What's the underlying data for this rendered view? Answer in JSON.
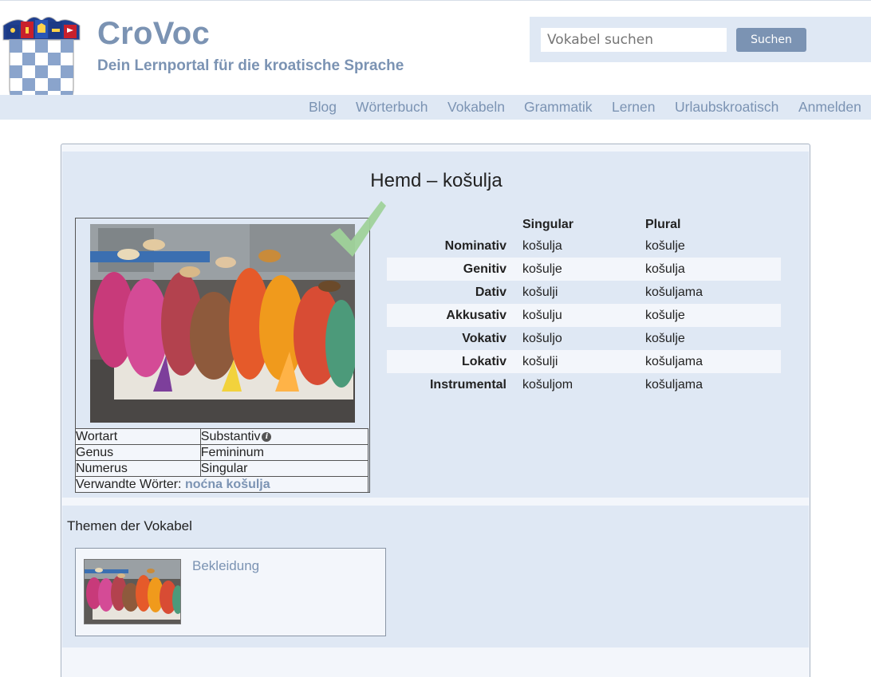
{
  "brand": {
    "title": "CroVoc",
    "subtitle": "Dein Lernportal für die kroatische Sprache"
  },
  "search": {
    "placeholder": "Vokabel suchen",
    "button_label": "Suchen"
  },
  "nav": {
    "items": [
      {
        "label": "Blog"
      },
      {
        "label": "Wörterbuch"
      },
      {
        "label": "Vokabeln"
      },
      {
        "label": "Grammatik"
      },
      {
        "label": "Lernen"
      },
      {
        "label": "Urlaubskroatisch"
      },
      {
        "label": "Anmelden"
      }
    ]
  },
  "word": {
    "title": "Hemd – košulja"
  },
  "info": {
    "rows": [
      {
        "key": "Wortart",
        "value": "Substantiv"
      },
      {
        "key": "Genus",
        "value": "Femininum"
      },
      {
        "key": "Numerus",
        "value": "Singular"
      }
    ],
    "related_label": "Verwandte Wörter:",
    "related_link": "noćna košulja"
  },
  "declension": {
    "headers": {
      "singular": "Singular",
      "plural": "Plural"
    },
    "rows": [
      {
        "case": "Nominativ",
        "sg": "košulja",
        "pl": "košulje"
      },
      {
        "case": "Genitiv",
        "sg": "košulje",
        "pl": "košulja"
      },
      {
        "case": "Dativ",
        "sg": "košulji",
        "pl": "košuljama"
      },
      {
        "case": "Akkusativ",
        "sg": "košulju",
        "pl": "košulje"
      },
      {
        "case": "Vokativ",
        "sg": "košuljo",
        "pl": "košulje"
      },
      {
        "case": "Lokativ",
        "sg": "košulji",
        "pl": "košuljama"
      },
      {
        "case": "Instrumental",
        "sg": "košuljom",
        "pl": "košuljama"
      }
    ]
  },
  "topics": {
    "heading": "Themen der Vokabel",
    "items": [
      {
        "label": "Bekleidung"
      }
    ]
  },
  "colors": {
    "accent": "#7b93b3",
    "panel": "#dfe8f4",
    "panel_light": "#f3f6fb",
    "check_green": "#9fd29a"
  },
  "icons": {
    "logo": "croatian-coat-of-arms-icon",
    "check": "checkmark-icon",
    "info": "info-icon"
  }
}
